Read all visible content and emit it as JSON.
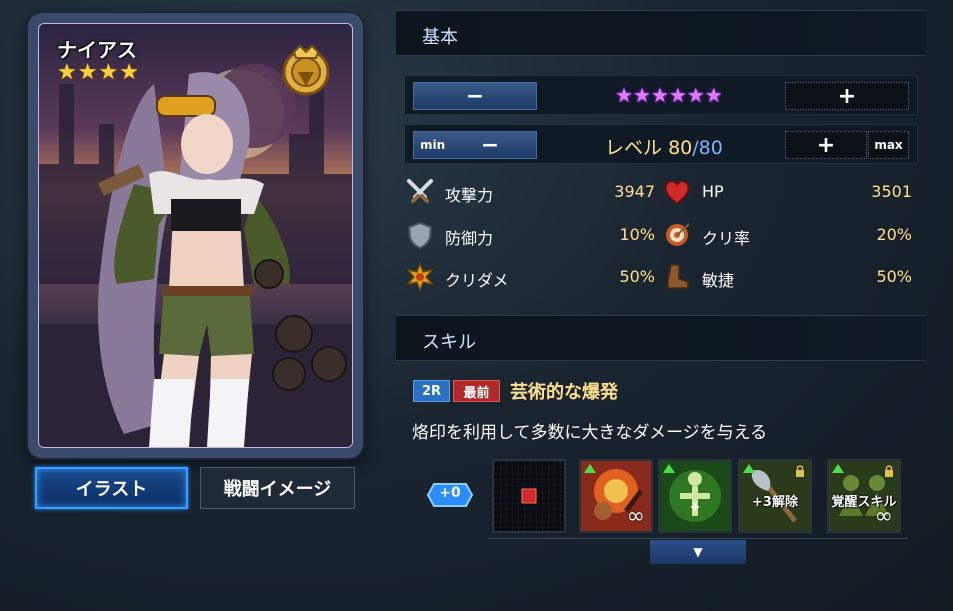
{
  "card": {
    "name": "ナイアス",
    "gold_stars": 4
  },
  "buttons": {
    "illust": "イラスト",
    "battle_image": "戦闘イメージ"
  },
  "basic": {
    "header": "基本",
    "rarity_purple_stars": 6,
    "minus": "−",
    "plus": "+",
    "min": "min",
    "max": "max",
    "level_prefix": "レベル",
    "level_current": "80",
    "level_max": "/80"
  },
  "stats": [
    {
      "icon": "crossed-swords-icon",
      "name": "攻撃力",
      "value": "3947"
    },
    {
      "icon": "heart-icon",
      "name": "HP",
      "value": "3501"
    },
    {
      "icon": "shield-icon",
      "name": "防御力",
      "value": "10%"
    },
    {
      "icon": "target-icon",
      "name": "クリ率",
      "value": "20%"
    },
    {
      "icon": "burst-icon",
      "name": "クリダメ",
      "value": "50%"
    },
    {
      "icon": "boot-icon",
      "name": "敏捷",
      "value": "50%"
    }
  ],
  "skill": {
    "header": "スキル",
    "tag_2r": "2R",
    "tag_front": "最前",
    "name": "芸術的な爆発",
    "description": "烙印を利用して多数に大きなダメージを与える",
    "plus_badge": "+0",
    "slot_labels": {
      "unlock": "+3解除",
      "awaken": "覚醒スキル"
    }
  },
  "colors": {
    "accent_blue": "#3aa0ff",
    "gold_text": "#ffe08a",
    "level_max_blue": "#7ab4ff",
    "tag_red": "#b02a2a",
    "tag_blue": "#2a70c0"
  }
}
